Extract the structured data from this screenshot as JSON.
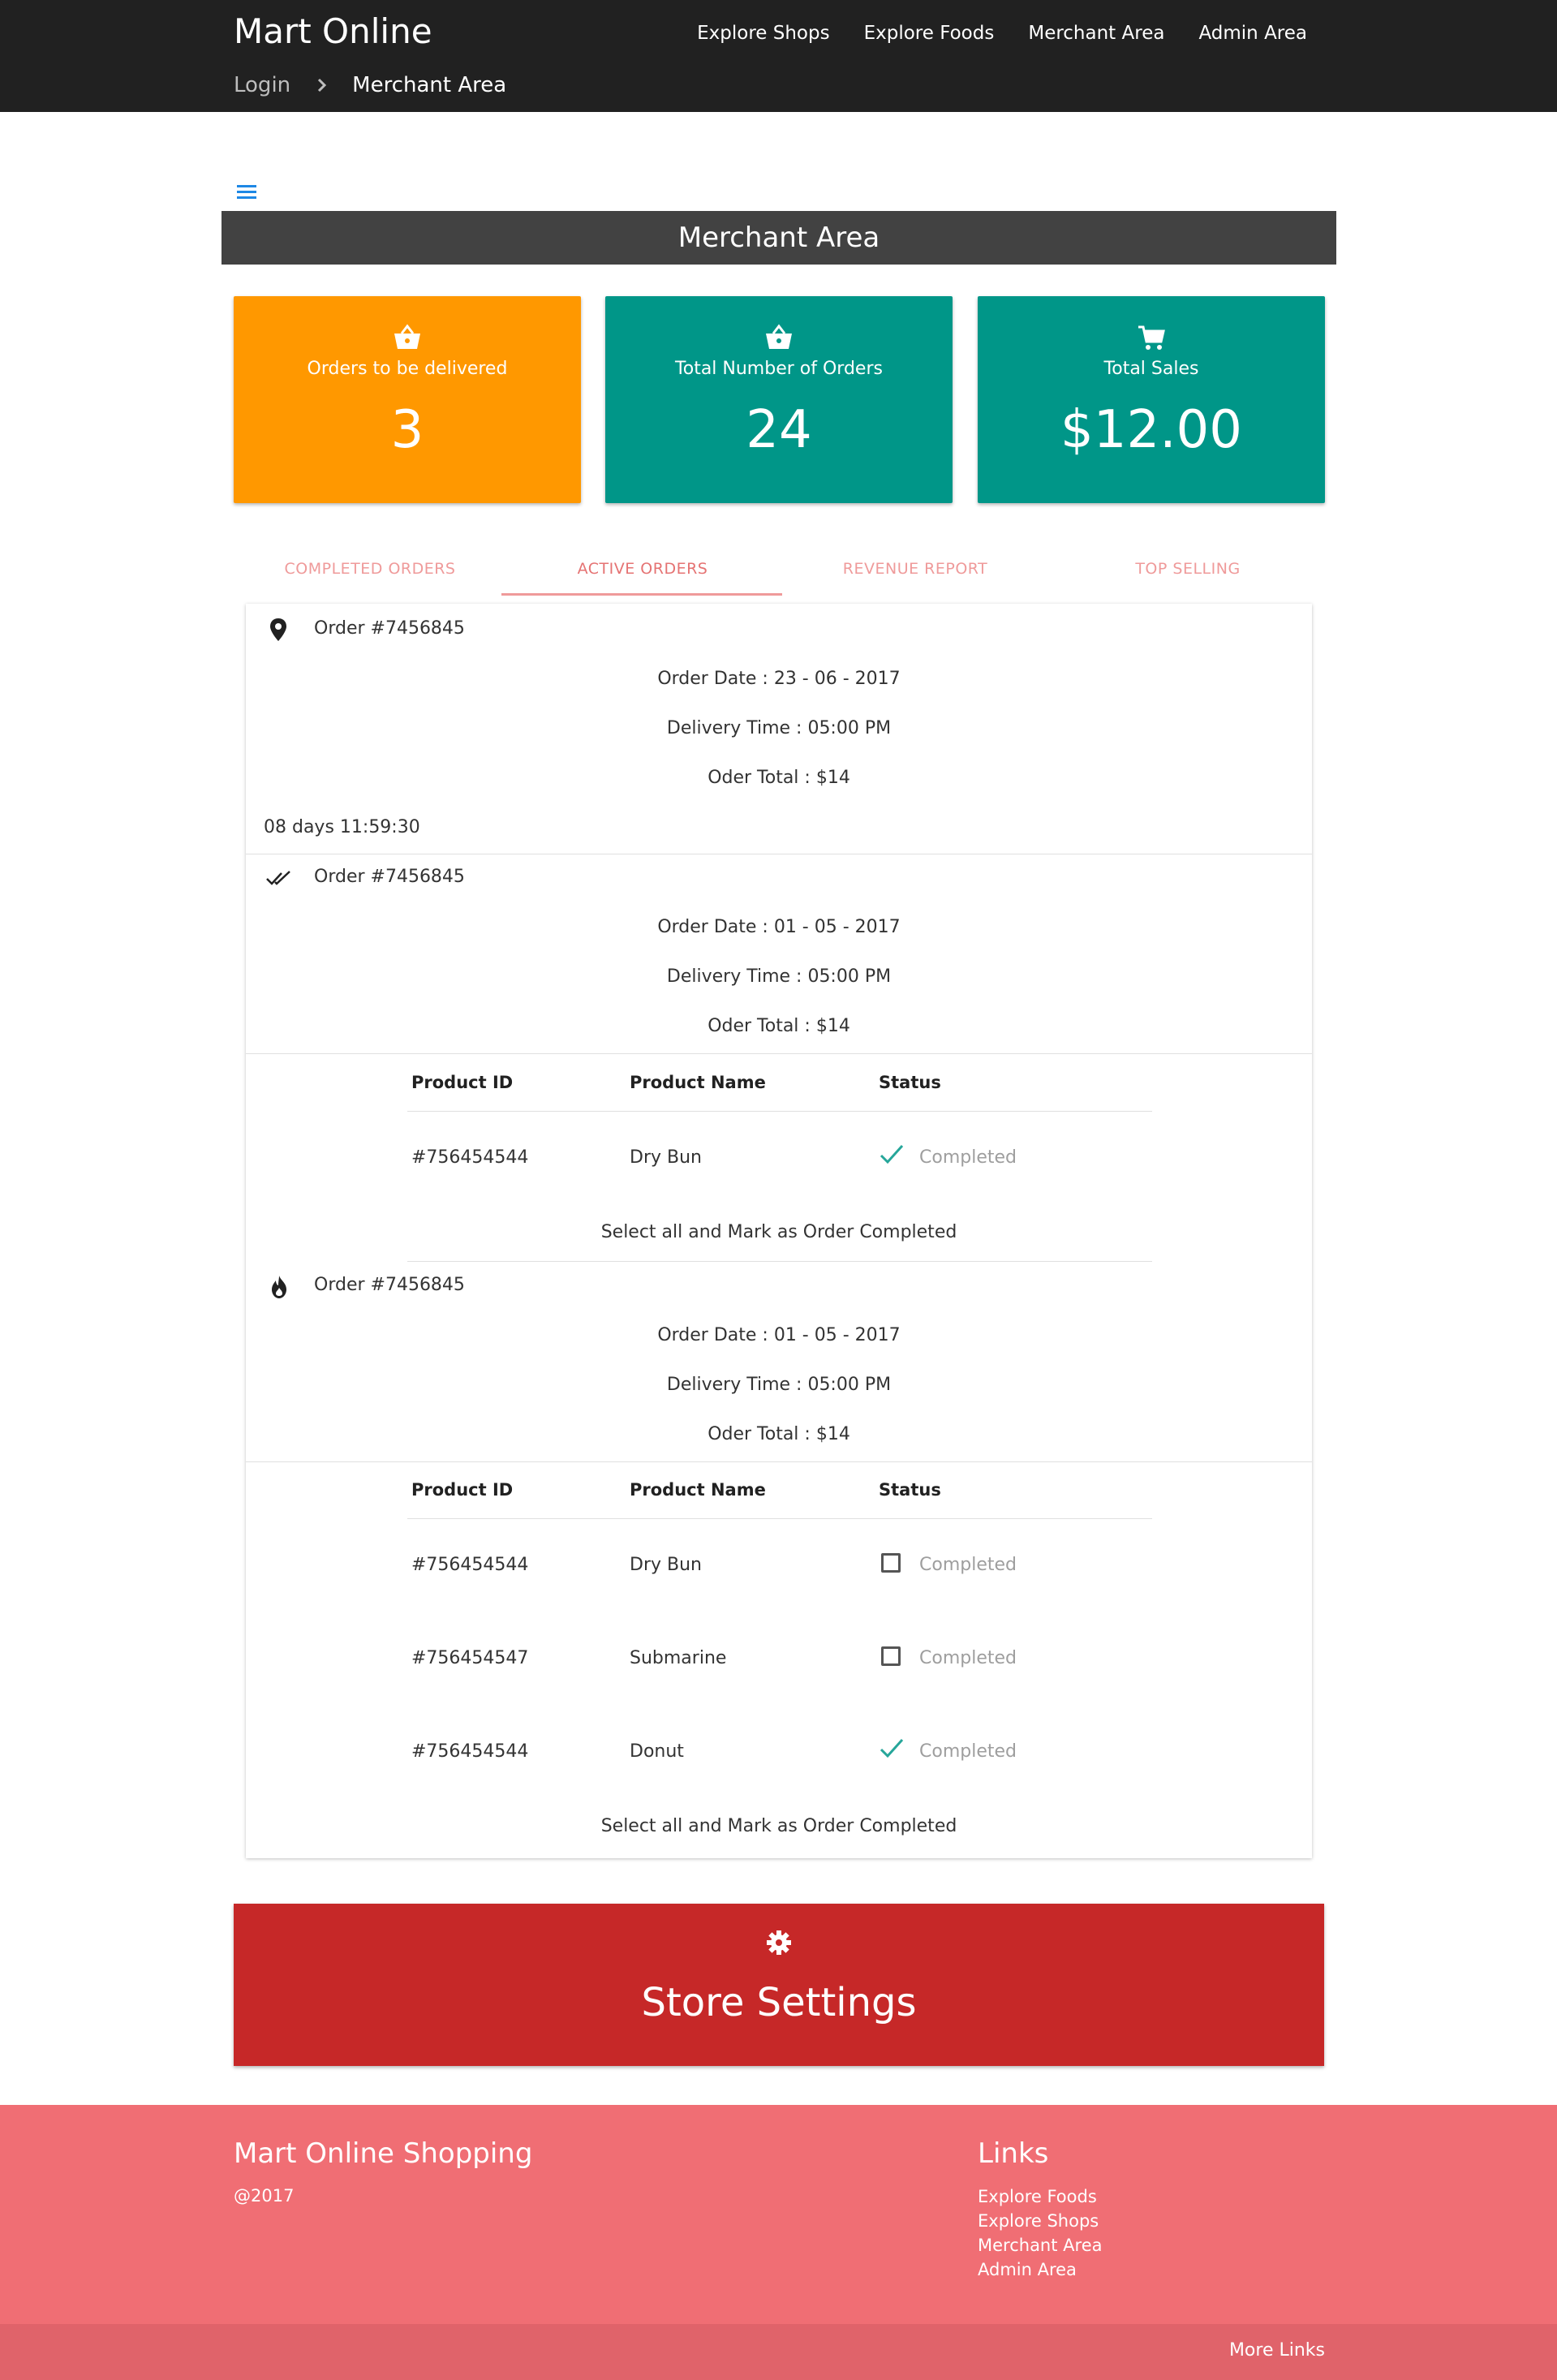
{
  "header": {
    "brand": "Mart Online",
    "nav": [
      "Explore Shops",
      "Explore Foods",
      "Merchant Area",
      "Admin Area"
    ],
    "breadcrumb": {
      "first": "Login",
      "current": "Merchant Area"
    }
  },
  "page_title": "Merchant Area",
  "stats": [
    {
      "icon": "basket-icon",
      "label": "Orders to be delivered",
      "value": "3",
      "color": "#ff9800"
    },
    {
      "icon": "basket-icon",
      "label": "Total Number of Orders",
      "value": "24",
      "color": "#009688"
    },
    {
      "icon": "cart-icon",
      "label": "Total Sales",
      "value": "$12.00",
      "color": "#009688"
    }
  ],
  "tabs": [
    "COMPLETED ORDERS",
    "ACTIVE ORDERS",
    "REVENUE REPORT",
    "TOP SELLING"
  ],
  "orders": [
    {
      "icon": "location-pin-icon",
      "title": "Order #7456845",
      "date": "Order Date : 23 - 06 - 2017",
      "delivery": "Delivery Time : 05:00 PM",
      "total": "Oder Total : $14",
      "countdown": "08 days 11:59:30"
    },
    {
      "icon": "double-check-icon",
      "title": "Order #7456845",
      "date": "Order Date : 01 - 05 - 2017",
      "delivery": "Delivery Time : 05:00 PM",
      "total": "Oder Total : $14",
      "columns": [
        "Product ID",
        "Product Name",
        "Status"
      ],
      "items": [
        {
          "id": "#756454544",
          "name": "Dry Bun",
          "status": "Completed",
          "checked": true
        }
      ],
      "select_all": "Select all and Mark as Order Completed"
    },
    {
      "icon": "flame-icon",
      "title": "Order #7456845",
      "date": "Order Date : 01 - 05 - 2017",
      "delivery": "Delivery Time : 05:00 PM",
      "total": "Oder Total : $14",
      "columns": [
        "Product ID",
        "Product Name",
        "Status"
      ],
      "items": [
        {
          "id": "#756454544",
          "name": "Dry Bun",
          "status": "Completed",
          "checked": false
        },
        {
          "id": "#756454547",
          "name": "Submarine",
          "status": "Completed",
          "checked": false
        },
        {
          "id": "#756454544",
          "name": "Donut",
          "status": "Completed",
          "checked": true
        }
      ],
      "select_all": "Select all and Mark as Order Completed"
    }
  ],
  "store_settings": {
    "icon": "gear-icon",
    "label": "Store Settings",
    "color": "#c62828"
  },
  "footer": {
    "title": "Mart Online Shopping",
    "copyright": "@2017",
    "links_title": "Links",
    "links": [
      "Explore Foods",
      "Explore Shops",
      "Merchant Area",
      "Admin Area"
    ],
    "more_links": "More Links"
  },
  "colors": {
    "accent": "#f06e74",
    "tab_text": "#ef9a9a",
    "check": "#26a69a"
  }
}
